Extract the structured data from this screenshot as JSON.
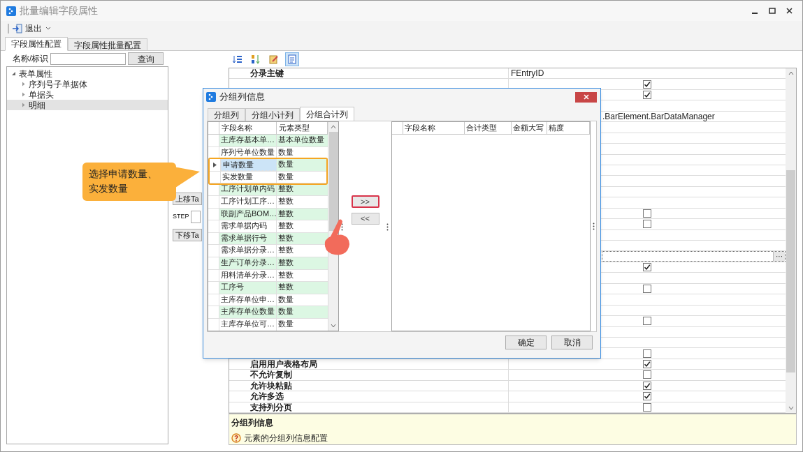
{
  "window": {
    "title": "批量编辑字段属性"
  },
  "toolbar": {
    "exit_label": "退出"
  },
  "tabs": [
    {
      "label": "字段属性配置",
      "selected": true
    },
    {
      "label": "字段属性批量配置",
      "selected": false
    }
  ],
  "search": {
    "label": "名称/标识",
    "button": "查询"
  },
  "tree": [
    {
      "label": "表单属性",
      "expanded": true,
      "selected": false,
      "children": [
        {
          "label": "序列号子单据体",
          "expanded": false,
          "selected": false
        },
        {
          "label": "单据头",
          "expanded": false,
          "selected": false
        },
        {
          "label": "明细",
          "expanded": false,
          "selected": true
        }
      ]
    }
  ],
  "move_panel": {
    "up_button": "上移Ta",
    "step_label": "STEP",
    "down_button": "下移Ta"
  },
  "grid_toolbar": [
    {
      "kind": "sort-list",
      "selected": false
    },
    {
      "kind": "sort-alpha",
      "selected": false
    },
    {
      "kind": "edit",
      "selected": false
    },
    {
      "kind": "page",
      "selected": true
    }
  ],
  "property_grid": {
    "rows": [
      {
        "kind": "text",
        "name": "分录主键",
        "value": "FEntryID"
      },
      {
        "kind": "check",
        "checked": true
      },
      {
        "kind": "check",
        "checked": true
      },
      {
        "kind": "blank"
      },
      {
        "kind": "partial",
        "value": ".BarElement.BarDataManager"
      },
      {
        "kind": "blank"
      },
      {
        "kind": "blank"
      },
      {
        "kind": "blank"
      },
      {
        "kind": "blank"
      },
      {
        "kind": "blank"
      },
      {
        "kind": "blank"
      },
      {
        "kind": "blank"
      },
      {
        "kind": "blank"
      },
      {
        "kind": "check",
        "checked": false
      },
      {
        "kind": "check",
        "checked": false
      },
      {
        "kind": "blank"
      },
      {
        "kind": "blank"
      },
      {
        "kind": "ellipsis",
        "button": "···"
      },
      {
        "kind": "check",
        "checked": true
      },
      {
        "kind": "blank"
      },
      {
        "kind": "check",
        "checked": false
      },
      {
        "kind": "blank"
      },
      {
        "kind": "blank"
      },
      {
        "kind": "check",
        "checked": false
      },
      {
        "kind": "blank"
      },
      {
        "kind": "blank"
      },
      {
        "kind": "check",
        "checked": false
      },
      {
        "kind": "check",
        "name": "启用用户表格布局",
        "checked": true
      },
      {
        "kind": "check",
        "name": "不允许复制",
        "checked": false
      },
      {
        "kind": "check",
        "name": "允许块粘贴",
        "checked": true
      },
      {
        "kind": "check",
        "name": "允许多选",
        "checked": true
      },
      {
        "kind": "check",
        "name": "支持列分页",
        "checked": false
      }
    ]
  },
  "info": {
    "title": "分组列信息",
    "description": "元素的分组列信息配置"
  },
  "dialog": {
    "title": "分组列信息",
    "tabs": [
      {
        "label": "分组列",
        "selected": false
      },
      {
        "label": "分组小计列",
        "selected": false
      },
      {
        "label": "分组合计列",
        "selected": true
      }
    ],
    "source_grid": {
      "columns": [
        "字段名称",
        "元素类型"
      ],
      "rows": [
        {
          "name": "主库存基本单…",
          "type": "基本单位数量",
          "selected": false,
          "highlighted": false
        },
        {
          "name": "序列号单位数量",
          "type": "数量",
          "selected": false,
          "highlighted": false
        },
        {
          "name": "申请数量",
          "type": "数量",
          "selected": true,
          "highlighted": true
        },
        {
          "name": "实发数量",
          "type": "数量",
          "selected": false,
          "highlighted": true
        },
        {
          "name": "工序计划单内码",
          "type": "整数",
          "selected": false,
          "highlighted": false
        },
        {
          "name": "工序计划工序…",
          "type": "整数",
          "selected": false,
          "highlighted": false
        },
        {
          "name": "联副产品BOM…",
          "type": "整数",
          "selected": false,
          "highlighted": false
        },
        {
          "name": "需求单据内码",
          "type": "整数",
          "selected": false,
          "highlighted": false
        },
        {
          "name": "需求单据行号",
          "type": "整数",
          "selected": false,
          "highlighted": false
        },
        {
          "name": "需求单据分录…",
          "type": "整数",
          "selected": false,
          "highlighted": false
        },
        {
          "name": "生产订单分录…",
          "type": "整数",
          "selected": false,
          "highlighted": false
        },
        {
          "name": "用料清单分录…",
          "type": "整数",
          "selected": false,
          "highlighted": false
        },
        {
          "name": "工序号",
          "type": "整数",
          "selected": false,
          "highlighted": false
        },
        {
          "name": "主库存单位申…",
          "type": "数量",
          "selected": false,
          "highlighted": false
        },
        {
          "name": "主库存单位数量",
          "type": "数量",
          "selected": false,
          "highlighted": false
        },
        {
          "name": "主库存单位可…",
          "type": "数量",
          "selected": false,
          "highlighted": false
        }
      ]
    },
    "add_button": ">>",
    "remove_button": "<<",
    "target_grid": {
      "columns": [
        "字段名称",
        "合计类型",
        "金额大写",
        "精度"
      ]
    },
    "buttons": [
      "确定",
      "取消"
    ]
  },
  "annotation": {
    "text": "选择申请数量、实发数量"
  }
}
